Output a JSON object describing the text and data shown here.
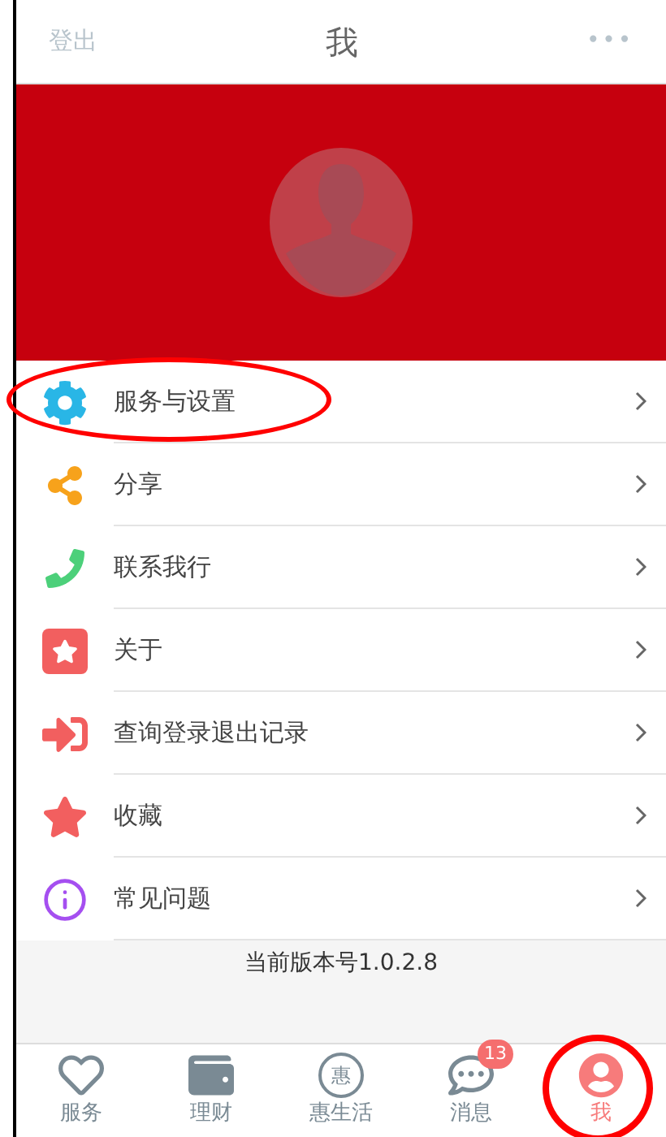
{
  "header": {
    "left": "登出",
    "title": "我",
    "more": "•••"
  },
  "menu": [
    {
      "kind": "gear",
      "label": "服务与设置",
      "circled": true
    },
    {
      "kind": "share",
      "label": "分享",
      "circled": false
    },
    {
      "kind": "phone",
      "label": "联系我行",
      "circled": false
    },
    {
      "kind": "star-square",
      "label": "关于",
      "circled": false
    },
    {
      "kind": "sign-in",
      "label": "查询登录退出记录",
      "circled": false
    },
    {
      "kind": "star",
      "label": "收藏",
      "circled": false
    },
    {
      "kind": "info",
      "label": "常见问题",
      "circled": false
    }
  ],
  "version": "当前版本号1.0.2.8",
  "tabs": [
    {
      "kind": "heart",
      "label": "服务",
      "selected": false,
      "circled": false
    },
    {
      "kind": "wallet",
      "label": "理财",
      "selected": false,
      "circled": false
    },
    {
      "kind": "hui",
      "label": "惠生活",
      "icon_text": "惠",
      "selected": false,
      "circled": false
    },
    {
      "kind": "chat",
      "label": "消息",
      "badge": "13",
      "selected": false,
      "circled": false
    },
    {
      "kind": "user",
      "label": "我",
      "selected": true,
      "circled": true
    }
  ]
}
